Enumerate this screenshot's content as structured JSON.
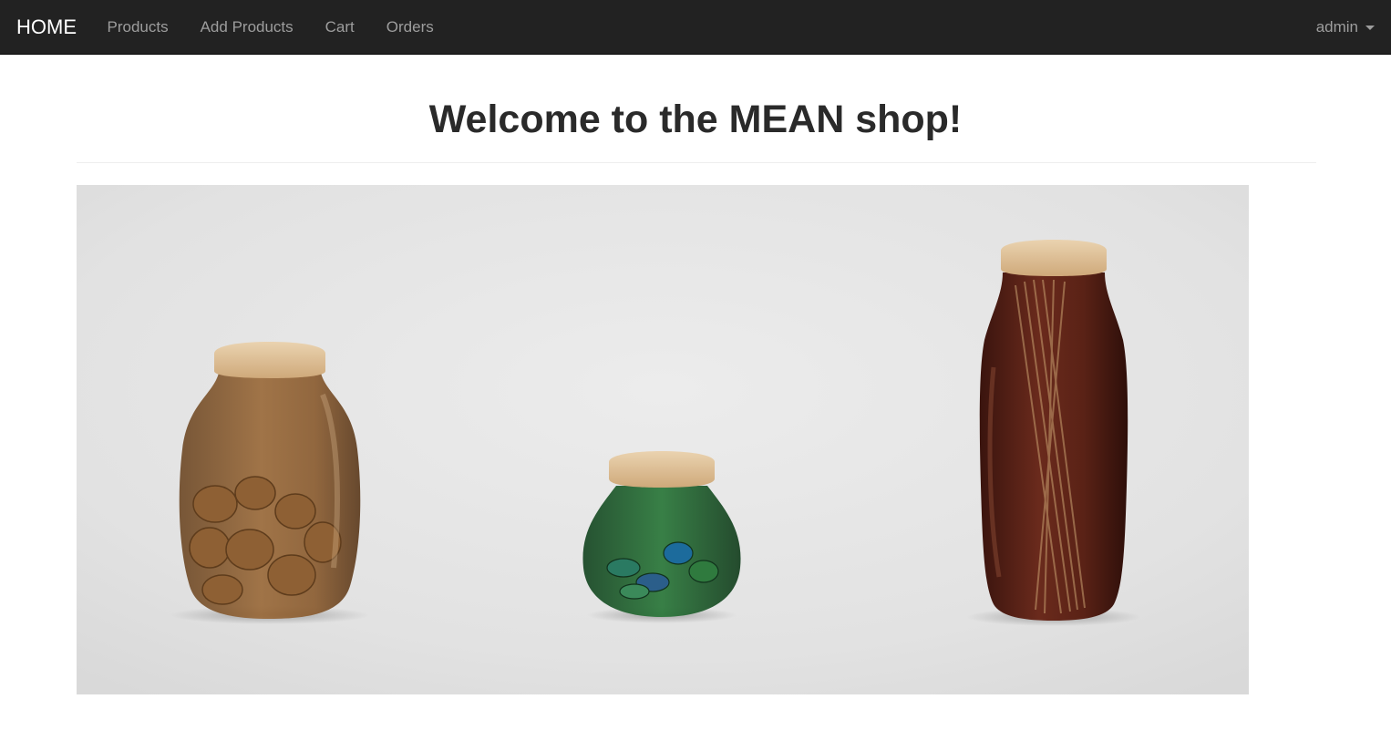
{
  "navbar": {
    "brand": "HOME",
    "links": [
      {
        "label": "Products"
      },
      {
        "label": "Add Products"
      },
      {
        "label": "Cart"
      },
      {
        "label": "Orders"
      }
    ],
    "user": "admin",
    "background": "#222222",
    "link_color": "#9d9d9d"
  },
  "main": {
    "title": "Welcome to the MEAN shop!"
  },
  "hero": {
    "content": [
      "amber-jar-with-walnuts",
      "green-jar-with-spools",
      "brown-bottle-with-spaghetti"
    ]
  }
}
